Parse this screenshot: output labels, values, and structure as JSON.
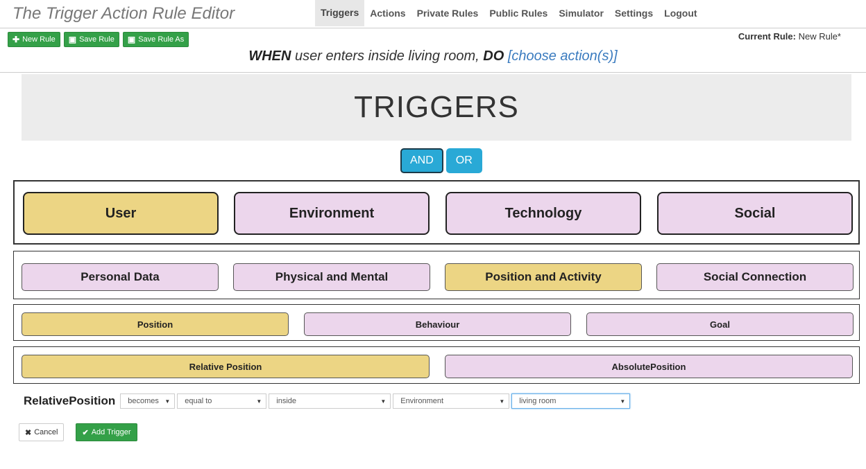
{
  "app_title": "The Trigger Action Rule Editor",
  "nav": [
    "Triggers",
    "Actions",
    "Private Rules",
    "Public Rules",
    "Simulator",
    "Settings",
    "Logout"
  ],
  "toolbar": {
    "new_rule": "New Rule",
    "save_rule": "Save Rule",
    "save_rule_as": "Save Rule As"
  },
  "current_rule": {
    "label": "Current Rule:",
    "value": "New Rule*"
  },
  "sentence": {
    "when": "WHEN",
    "condition": "user enters inside living room,",
    "do": "DO",
    "action": "[choose action(s)]"
  },
  "banner": "TRIGGERS",
  "logic": {
    "and": "AND",
    "or": "OR"
  },
  "categories": [
    "User",
    "Environment",
    "Technology",
    "Social"
  ],
  "subcategories": [
    "Personal Data",
    "Physical and Mental",
    "Position and Activity",
    "Social Connection"
  ],
  "subsub": [
    "Position",
    "Behaviour",
    "Goal"
  ],
  "position_types": [
    "Relative Position",
    "AbsolutePosition"
  ],
  "form": {
    "label": "RelativePosition",
    "selects": [
      "becomes",
      "equal to",
      "inside",
      "Environment",
      "living room"
    ]
  },
  "buttons": {
    "cancel": "Cancel",
    "add_trigger": "Add Trigger"
  },
  "colors": {
    "selected": "#ecd584",
    "unselected": "#ecd6ec",
    "primary_green": "#34a048",
    "logic_blue": "#29a9d6"
  }
}
